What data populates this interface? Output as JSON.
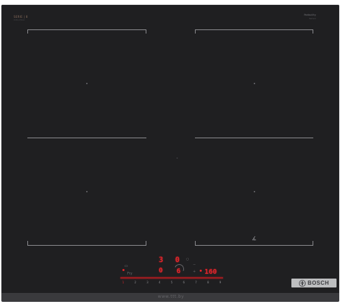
{
  "branding": {
    "logo_left_top": "SERIE | 8",
    "logo_left_sub": "induction",
    "logo_right_top": "PerfectFry",
    "logo_right_sub": "Sensor",
    "brand": "BOSCH",
    "watermark": "www.ttt.by"
  },
  "control_panel": {
    "timer_top_left": "3",
    "timer_top_right": "0",
    "power_left": "0",
    "power_right": "6",
    "temperature": "160",
    "scale": [
      "1",
      "2",
      "3",
      "4",
      "5",
      "6",
      "7",
      "8",
      "9"
    ],
    "active_scale_index": 0,
    "fry_label": "Fry"
  },
  "icons": {
    "zone_bottom_right": "pan-detect-icon",
    "brand_mark": "bosch-armature-icon"
  },
  "colors": {
    "surface": "#1f1f21",
    "display_red": "#e5252b",
    "zone_lines": "#8e8e92",
    "badge": "#bdbec0"
  }
}
